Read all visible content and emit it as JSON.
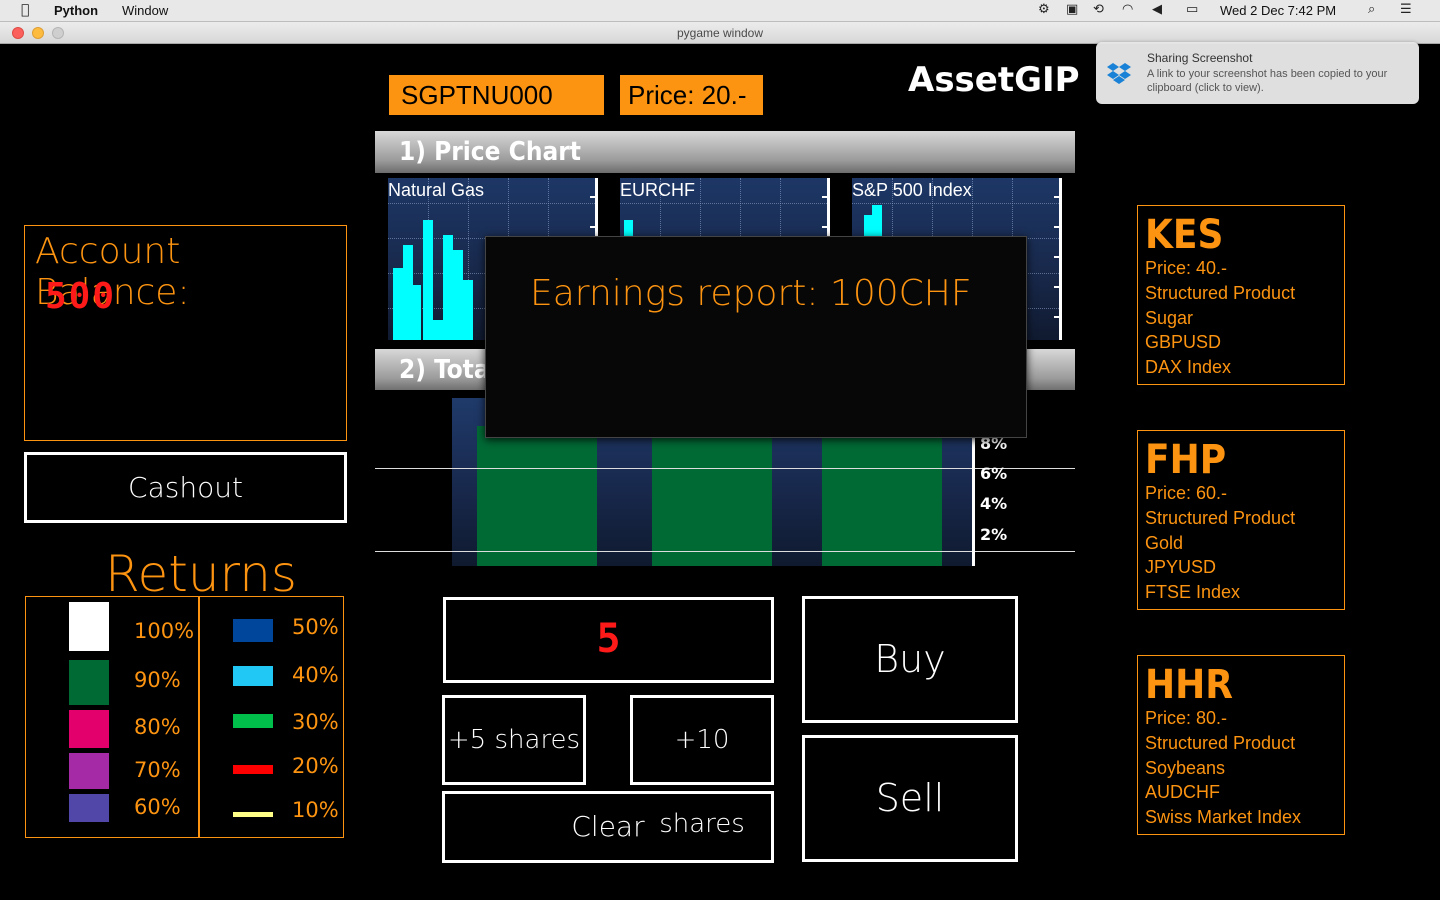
{
  "menubar": {
    "app": "Python",
    "menu": [
      "Window"
    ],
    "clock": "Wed 2 Dec  7:42 PM"
  },
  "window": {
    "title": "pygame window"
  },
  "notification": {
    "title": "Sharing Screenshot",
    "body": "A link to your screenshot has been copied to your clipboard (click to view)."
  },
  "header": {
    "ticker": "SGPTNU000",
    "price": "Price: 20.-",
    "brand": "AssetGIP"
  },
  "sections": {
    "price_chart": "1) Price Chart",
    "total": "2) Tota"
  },
  "mini_charts": [
    {
      "title": "Natural Gas"
    },
    {
      "title": "EURCHF"
    },
    {
      "title": "S&P 500 Index"
    }
  ],
  "big_chart": {
    "ylabels": [
      "8%",
      "6%",
      "4%",
      "2%"
    ]
  },
  "modal": {
    "message": "Earnings report:  100CHF"
  },
  "account": {
    "label": "Account Balance:",
    "value": "500",
    "cashout": "Cashout"
  },
  "returns": {
    "title": "Returns",
    "legend": [
      {
        "label": "100%",
        "color": "#ffffff"
      },
      {
        "label": "90%",
        "color": "#006a35"
      },
      {
        "label": "80%",
        "color": "#e3006d"
      },
      {
        "label": "70%",
        "color": "#a52aa5"
      },
      {
        "label": "60%",
        "color": "#5047a8"
      },
      {
        "label": "50%",
        "color": "#00479c"
      },
      {
        "label": "40%",
        "color": "#22c8f5"
      },
      {
        "label": "30%",
        "color": "#00c04b"
      },
      {
        "label": "20%",
        "color": "#ff0000"
      },
      {
        "label": "10%",
        "color": "#ffff88"
      }
    ]
  },
  "trade": {
    "quantity": "5",
    "plus5": "+5 shares",
    "plus10": "+10 shares",
    "clear": "Clear",
    "buy": "Buy",
    "sell": "Sell"
  },
  "assets": [
    {
      "name": "KES",
      "lines": [
        "Price: 40.-",
        "Structured Product",
        "Sugar",
        "GBPUSD",
        "DAX Index"
      ]
    },
    {
      "name": "FHP",
      "lines": [
        "Price: 60.-",
        "Structured Product",
        "Gold",
        "JPYUSD",
        "FTSE Index"
      ]
    },
    {
      "name": "HHR",
      "lines": [
        "Price: 80.-",
        "Structured Product",
        "Soybeans",
        "AUDCHF",
        "Swiss Market Index"
      ]
    }
  ]
}
